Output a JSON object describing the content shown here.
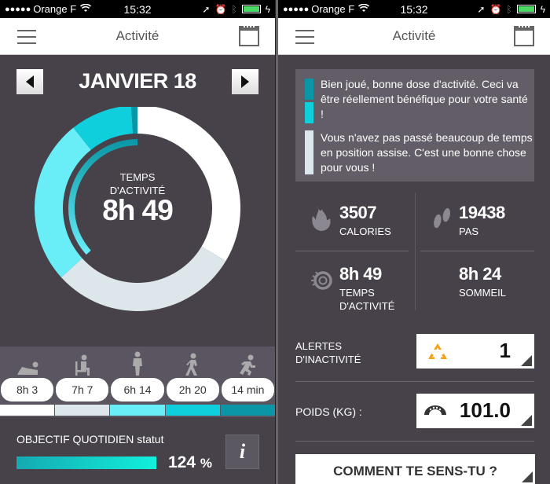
{
  "status_bar": {
    "signal": "●●●●●",
    "carrier": "Orange F",
    "wifi": "wifi-icon",
    "time": "15:32",
    "battery_color": "#4cd964"
  },
  "nav": {
    "title": "Activité"
  },
  "left": {
    "month": "JANVIER 18",
    "center_label_1": "TEMPS",
    "center_label_2": "D'ACTIVITÉ",
    "center_value": "8h 49",
    "breakdown": [
      {
        "activity": "lying",
        "label": "8h 3",
        "minutes": 483,
        "color": "#ffffff"
      },
      {
        "activity": "sitting",
        "label": "7h 7",
        "minutes": 427,
        "color": "#dde6ea"
      },
      {
        "activity": "standing",
        "label": "6h 14",
        "minutes": 374,
        "color": "#69eef8"
      },
      {
        "activity": "walking",
        "label": "2h 20",
        "minutes": 140,
        "color": "#0fcfdc"
      },
      {
        "activity": "running",
        "label": "14 min",
        "minutes": 14,
        "color": "#0a96a6"
      }
    ],
    "goal_title": "OBJECTIF QUOTIDIEN statut",
    "goal_percent_value": "124",
    "goal_percent_sign": "%",
    "goal_progress": 1.0,
    "info_label": "i"
  },
  "right": {
    "messages": [
      {
        "text": "Bien joué, bonne dose d'activité. Ceci va être réellement bénéfique pour votre santé !",
        "colors": [
          "#0a96a6",
          "#0fcfdc"
        ]
      },
      {
        "text": "Vous n'avez pas passé beaucoup de temps en position assise. C'est une bonne chose pour vous !",
        "colors": [
          "#dde6ea"
        ]
      }
    ],
    "stats": {
      "calories": {
        "value": "3507",
        "label": "CALORIES"
      },
      "steps": {
        "value": "19438",
        "label": "PAS"
      },
      "active_time": {
        "value": "8h 49",
        "label_1": "TEMPS",
        "label_2": "D'ACTIVITÉ"
      },
      "sleep": {
        "value": "8h 24",
        "label": "SOMMEIL"
      }
    },
    "inactivity": {
      "label_1": "ALERTES",
      "label_2": "D'INACTIVITÉ",
      "value": "1",
      "icon_color": "#f7a11a"
    },
    "weight": {
      "label": "POIDS (KG) :",
      "value": "101.0"
    },
    "feel_button": "COMMENT TE SENS-TU ?"
  }
}
